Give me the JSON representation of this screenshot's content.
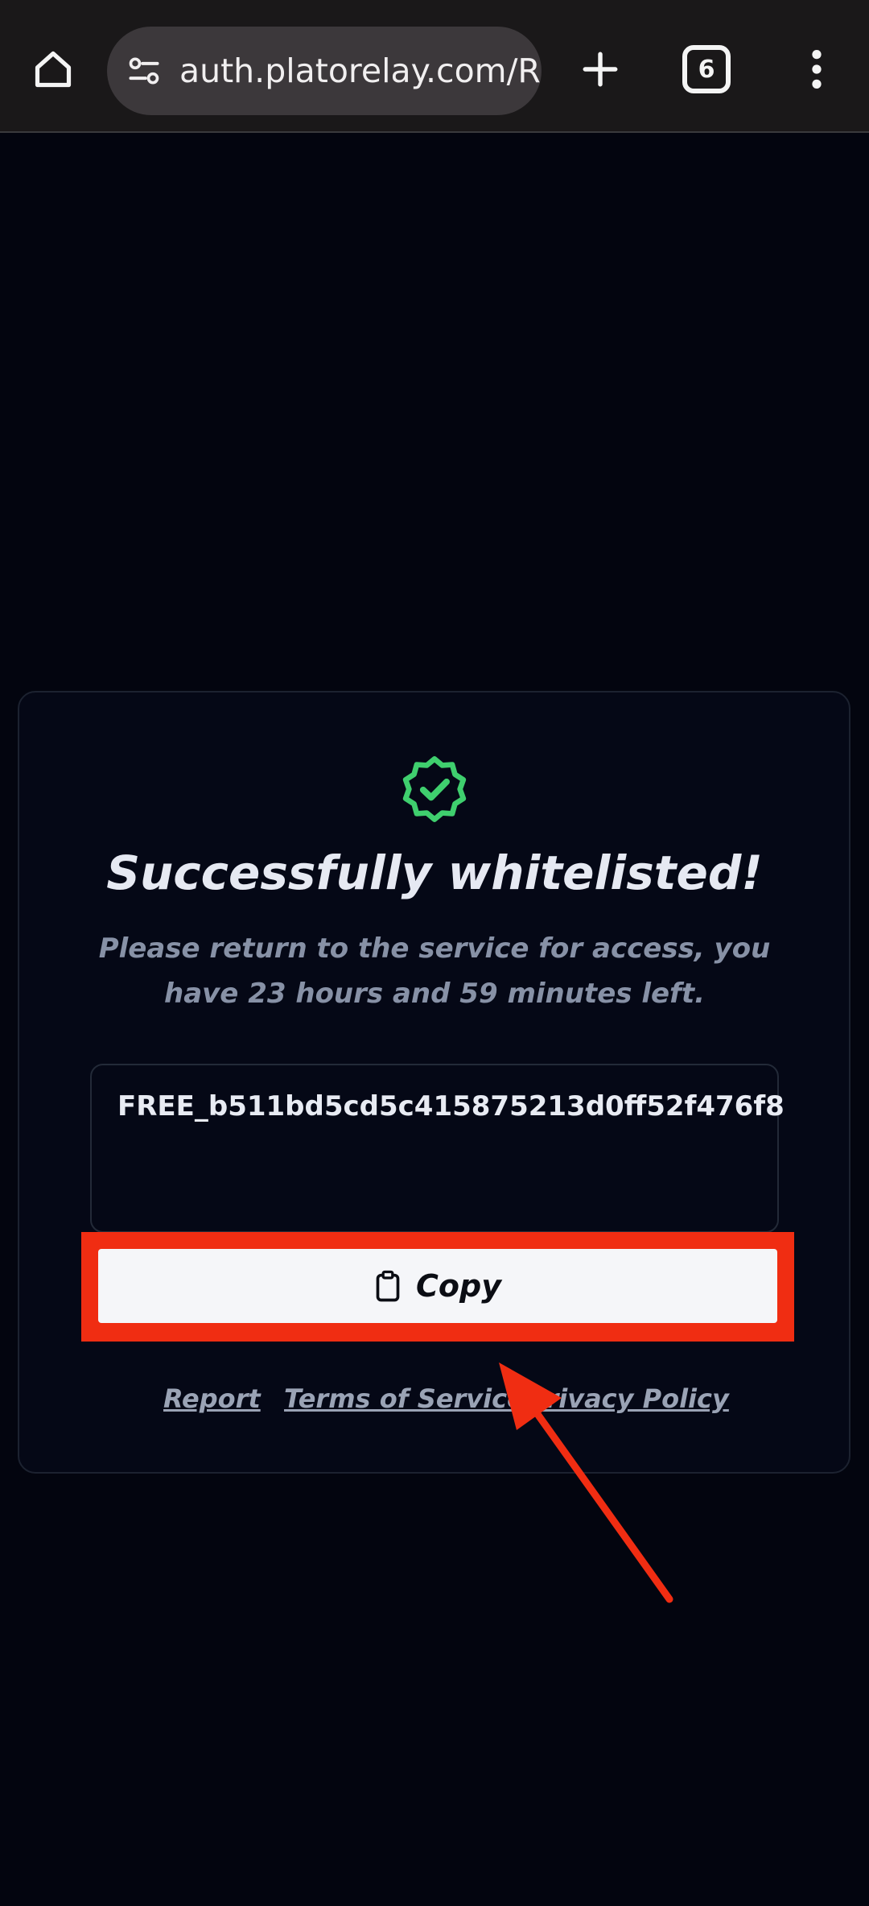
{
  "browser": {
    "url": "auth.platorelay.com/R",
    "tab_count": "6",
    "icons": [
      "home-icon",
      "site-settings-icon",
      "new-tab-icon",
      "tab-switcher-icon",
      "overflow-menu-icon"
    ]
  },
  "status": {
    "title": "Successfully whitelisted!",
    "message": "Please return to the service for access, you have 23 hours and 59 minutes left.",
    "badge_color": "#3fcf6e"
  },
  "key": {
    "value": "FREE_b511bd5cd5c415875213d0ff52f476f8"
  },
  "copy": {
    "label": "Copy"
  },
  "footer": {
    "report": "Report",
    "terms": "Terms of Service",
    "privacy": "Privacy Policy"
  },
  "annotation": {
    "highlight_color": "#f02d12"
  }
}
